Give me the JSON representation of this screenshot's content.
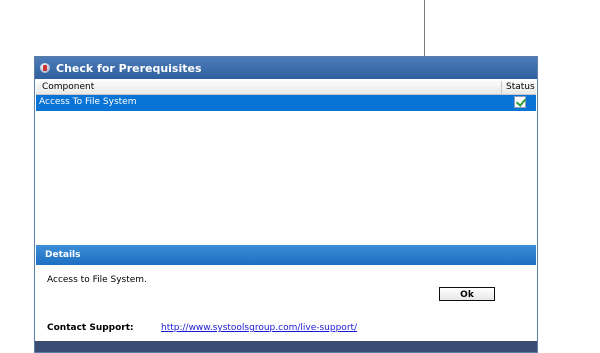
{
  "dialog": {
    "title": "Check for Prerequisites",
    "logo_icon": "app-logo-icon"
  },
  "table": {
    "columns": [
      "Component",
      "Status"
    ],
    "rows": [
      {
        "component": "Access To File System",
        "status": "check-icon",
        "selected": true
      }
    ]
  },
  "details": {
    "header": "Details",
    "text": "Access to File System.",
    "support_label": "Contact Support:",
    "support_link": "http://www.systoolsgroup.com/live-support/"
  },
  "buttons": {
    "ok_label": "Ok"
  },
  "colors": {
    "titlebar": "#3a6aa8",
    "selection": "#0a74d6",
    "details_bar": "#1c6fc2",
    "footer": "#3a4e73",
    "link": "#1a1ad6"
  }
}
